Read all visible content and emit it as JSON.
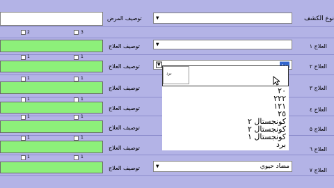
{
  "rows": [
    {
      "label": "نوع الكشف"
    },
    {
      "label": "العلاج ١"
    },
    {
      "label": "العلاج ٢"
    },
    {
      "label": "العلاج ٣"
    },
    {
      "label": "العلاج ٤"
    },
    {
      "label": "العلاج ٥"
    },
    {
      "label": "العلاج ٦"
    },
    {
      "label": "العلاج ٧"
    }
  ],
  "patient_desc_label": "توصيف المرض",
  "treatment_desc_label": "توصيف العلاج",
  "checkbox_labels": {
    "left": "2",
    "right": "3"
  },
  "small_num": "1",
  "dropdown_open_value": "برد",
  "popup_value": "برد",
  "list_options": [
    "٢٠",
    "٢٢٢",
    "١٢١",
    "٢٥",
    "كونجستال ٢",
    "كونجستال ٢",
    "كونجستال ١",
    "برد"
  ],
  "last_select_value": "مضاد حيوي"
}
